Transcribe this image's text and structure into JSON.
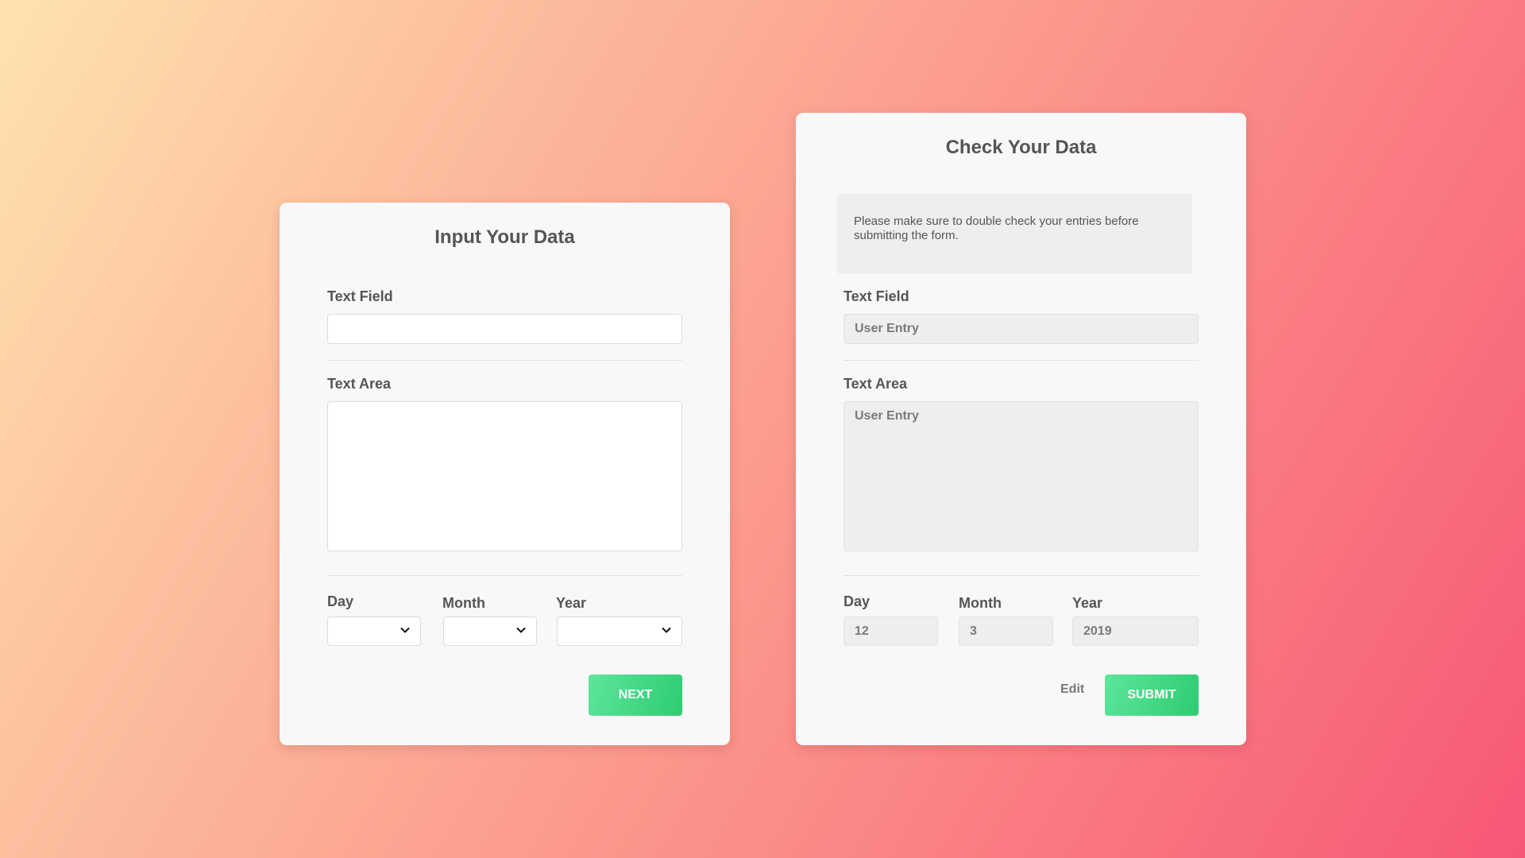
{
  "input_card": {
    "title": "Input Your Data",
    "text_field": {
      "label": "Text Field",
      "value": ""
    },
    "text_area": {
      "label": "Text Area",
      "value": ""
    },
    "day": {
      "label": "Day",
      "selected": ""
    },
    "month": {
      "label": "Month",
      "selected": ""
    },
    "year": {
      "label": "Year",
      "selected": ""
    },
    "next_label": "NEXT"
  },
  "check_card": {
    "title": "Check Your Data",
    "notice": "Please make sure to double check your entries before submitting the form.",
    "text_field": {
      "label": "Text Field",
      "value": "User Entry"
    },
    "text_area": {
      "label": "Text Area",
      "value": "User Entry"
    },
    "day": {
      "label": "Day",
      "value": "12"
    },
    "month": {
      "label": "Month",
      "value": "3"
    },
    "year": {
      "label": "Year",
      "value": "2019"
    },
    "edit_label": "Edit",
    "submit_label": "SUBMIT"
  },
  "icons": {
    "select_arrow": "chevron-down-icon"
  },
  "colors": {
    "background_start": "#ffe2b0",
    "background_end": "#f75777",
    "card": "#f8f8f8",
    "button_start": "#5ee59c",
    "button_end": "#2ecc71"
  }
}
